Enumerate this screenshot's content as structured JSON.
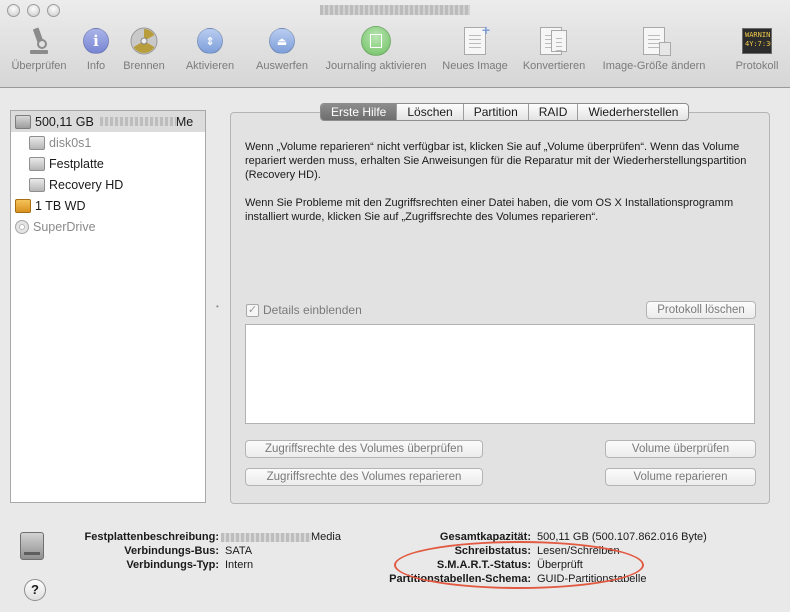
{
  "toolbar": {
    "items": [
      {
        "label": "Überprüfen",
        "icon": "microscope-icon"
      },
      {
        "label": "Info",
        "icon": "info-icon"
      },
      {
        "label": "Brennen",
        "icon": "burn-icon"
      },
      {
        "label": "Aktivieren",
        "icon": "mount-icon"
      },
      {
        "label": "Auswerfen",
        "icon": "eject-icon"
      },
      {
        "label": "Journaling aktivieren",
        "icon": "journaling-icon"
      },
      {
        "label": "Neues Image",
        "icon": "new-image-icon"
      },
      {
        "label": "Konvertieren",
        "icon": "convert-icon"
      },
      {
        "label": "Image-Größe ändern",
        "icon": "resize-image-icon"
      },
      {
        "label": "Protokoll",
        "icon": "log-icon"
      }
    ],
    "log_icon_text": "WARNIN\n4Y:7:36E"
  },
  "sidebar": {
    "items": [
      {
        "label": "500,11 GB",
        "suffix": "Me"
      },
      {
        "label": "disk0s1"
      },
      {
        "label": "Festplatte"
      },
      {
        "label": "Recovery HD"
      },
      {
        "label": "1 TB WD"
      },
      {
        "label": "SuperDrive"
      }
    ]
  },
  "tabs": [
    "Erste Hilfe",
    "Löschen",
    "Partition",
    "RAID",
    "Wiederherstellen"
  ],
  "first_aid": {
    "paragraph1": "Wenn „Volume reparieren“ nicht verfügbar ist, klicken Sie auf „Volume überprüfen“. Wenn das Volume repariert werden muss, erhalten Sie Anweisungen für die Reparatur mit der Wiederherstellungspartition (Recovery HD).",
    "paragraph2": "Wenn Sie Probleme mit den Zugriffsrechten einer Datei haben, die vom OS X Installationsprogramm installiert wurde, klicken Sie auf „Zugriffsrechte des Volumes reparieren“.",
    "show_details_label": "Details einblenden",
    "show_details_mark": "✓",
    "clear_log_label": "Protokoll löschen",
    "verify_permissions_label": "Zugriffsrechte des Volumes überprüfen",
    "repair_permissions_label": "Zugriffsrechte des Volumes reparieren",
    "verify_volume_label": "Volume überprüfen",
    "repair_volume_label": "Volume reparieren"
  },
  "info": {
    "description_label": "Festplattenbeschreibung:",
    "description_value": "Media",
    "bus_label": "Verbindungs-Bus:",
    "bus_value": "SATA",
    "type_label": "Verbindungs-Typ:",
    "type_value": "Intern",
    "capacity_label": "Gesamtkapazität:",
    "capacity_value": "500,11 GB (500.107.862.016 Byte)",
    "write_label": "Schreibstatus:",
    "write_value": "Lesen/Schreiben",
    "smart_label": "S.M.A.R.T.-Status:",
    "smart_value": "Überprüft",
    "scheme_label": "Partitionstabellen-Schema:",
    "scheme_value": "GUID-Partitionstabelle"
  },
  "help_button_label": "?",
  "colors": {
    "annotation": "#e25a42",
    "tab_active": "#7a7a7a"
  }
}
